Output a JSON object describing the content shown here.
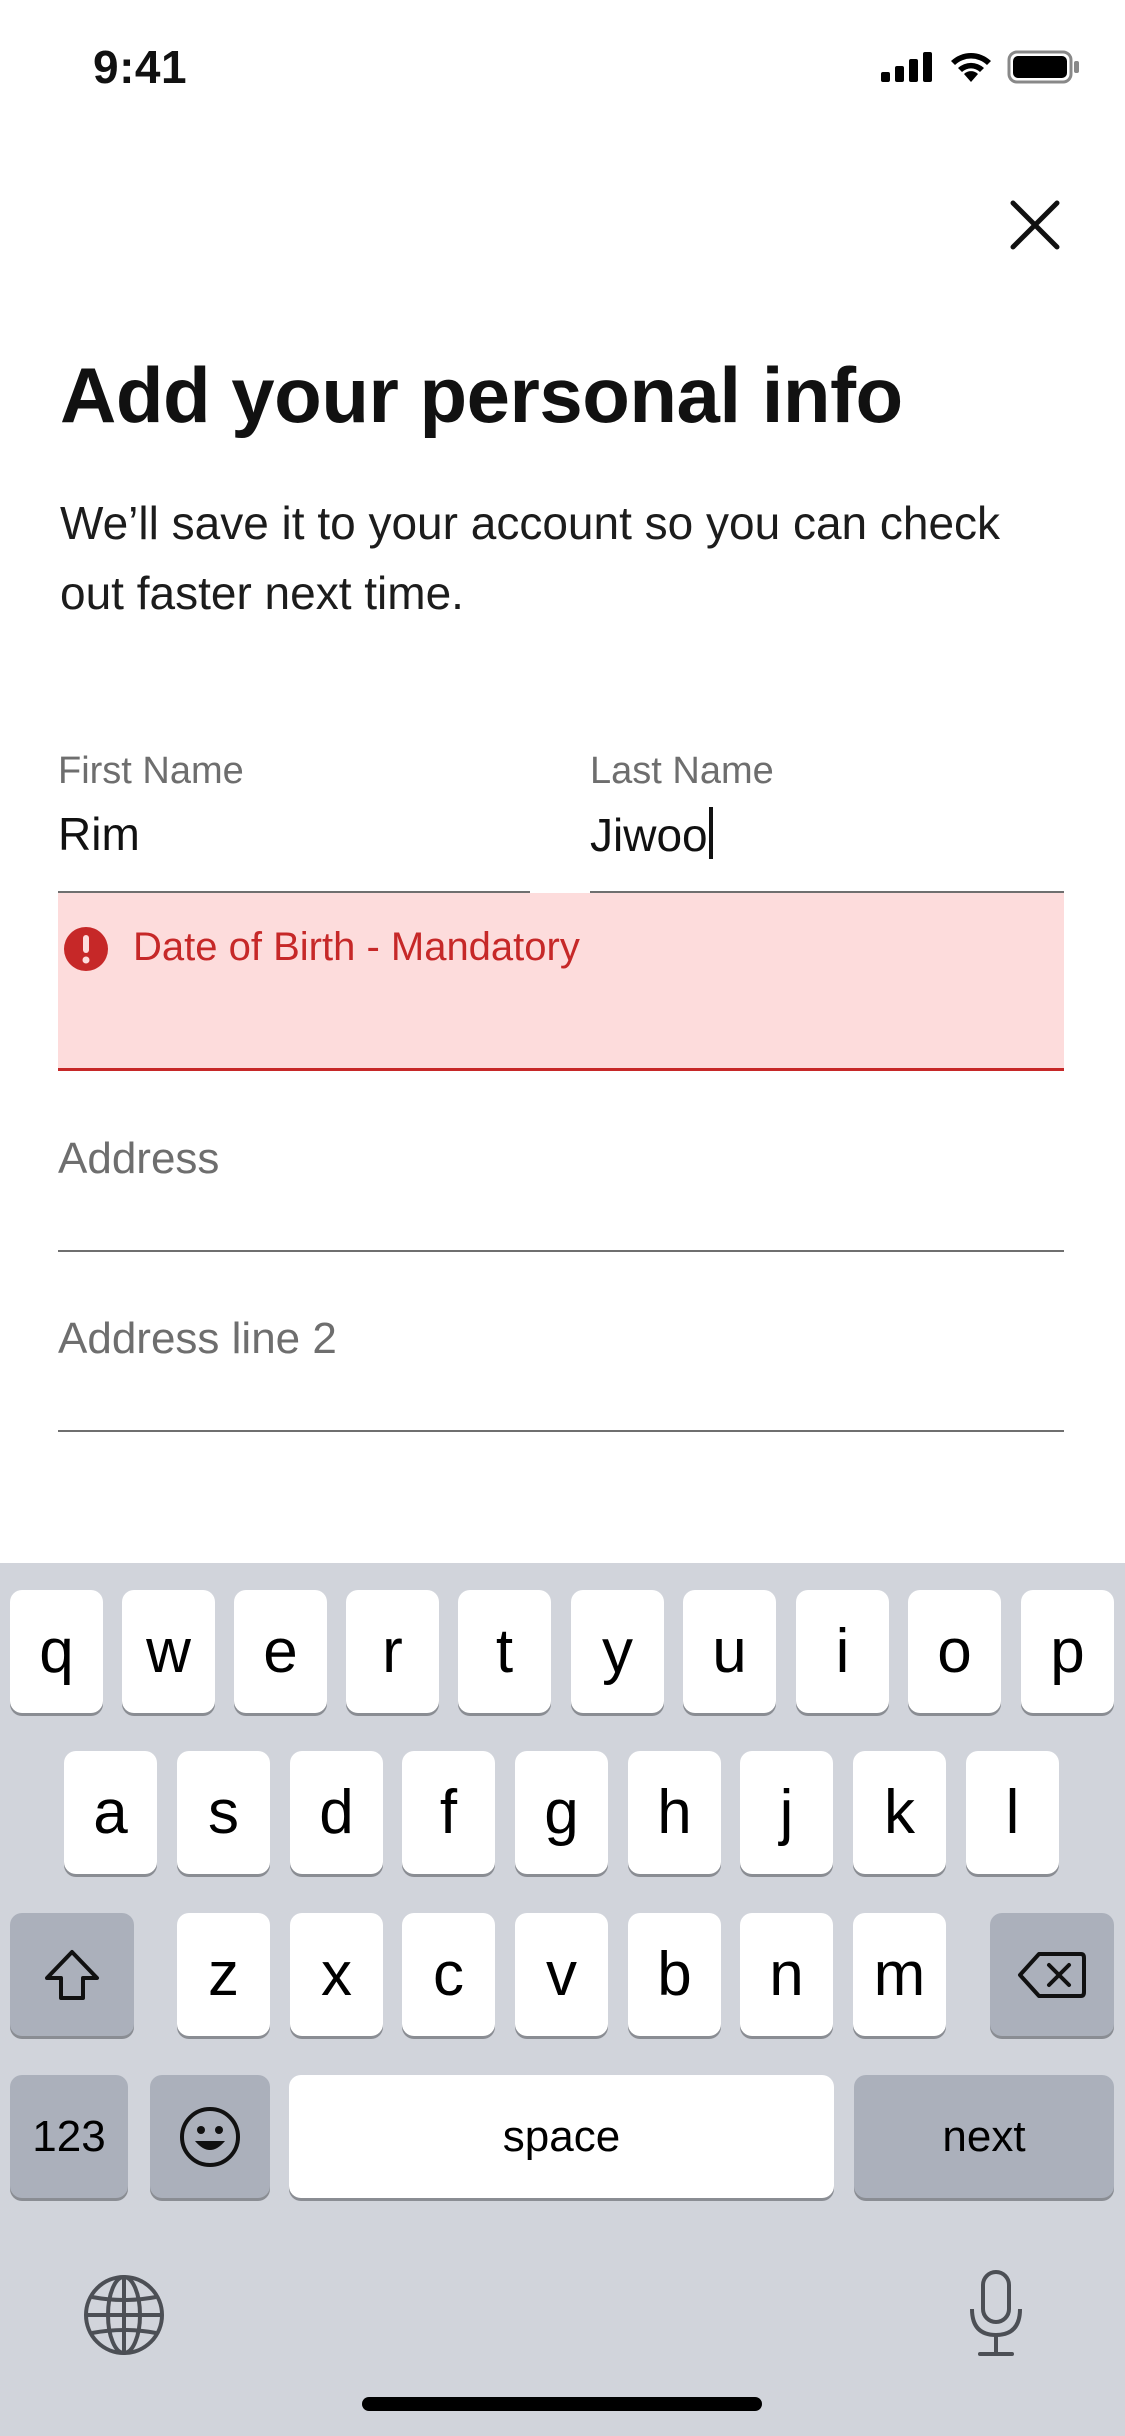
{
  "status_bar": {
    "time": "9:41",
    "icons": [
      "cellular-signal-icon",
      "wifi-icon",
      "battery-icon"
    ]
  },
  "header": {
    "close_icon": "close-icon",
    "title": "Add your personal info",
    "subtitle": "We’ll save it to your account so you can check out faster next time."
  },
  "form": {
    "first_name": {
      "label": "First Name",
      "value": "Rim"
    },
    "last_name": {
      "label": "Last Name",
      "value": "Jiwoo"
    },
    "dob_error": {
      "message": "Date of Birth - Mandatory",
      "icon": "error-icon",
      "color": "#c62828",
      "background": "#fddcdc"
    },
    "address": {
      "placeholder": "Address"
    },
    "address_line2": {
      "placeholder": "Address line 2"
    }
  },
  "keyboard": {
    "row1": [
      "q",
      "w",
      "e",
      "r",
      "t",
      "y",
      "u",
      "i",
      "o",
      "p"
    ],
    "row2": [
      "a",
      "s",
      "d",
      "f",
      "g",
      "h",
      "j",
      "k",
      "l"
    ],
    "row3": [
      "z",
      "x",
      "c",
      "v",
      "b",
      "n",
      "m"
    ],
    "shift_icon": "shift-icon",
    "delete_icon": "backspace-icon",
    "numbers_label": "123",
    "emoji_icon": "emoji-icon",
    "space_label": "space",
    "next_label": "next",
    "globe_icon": "globe-icon",
    "mic_icon": "microphone-icon"
  }
}
